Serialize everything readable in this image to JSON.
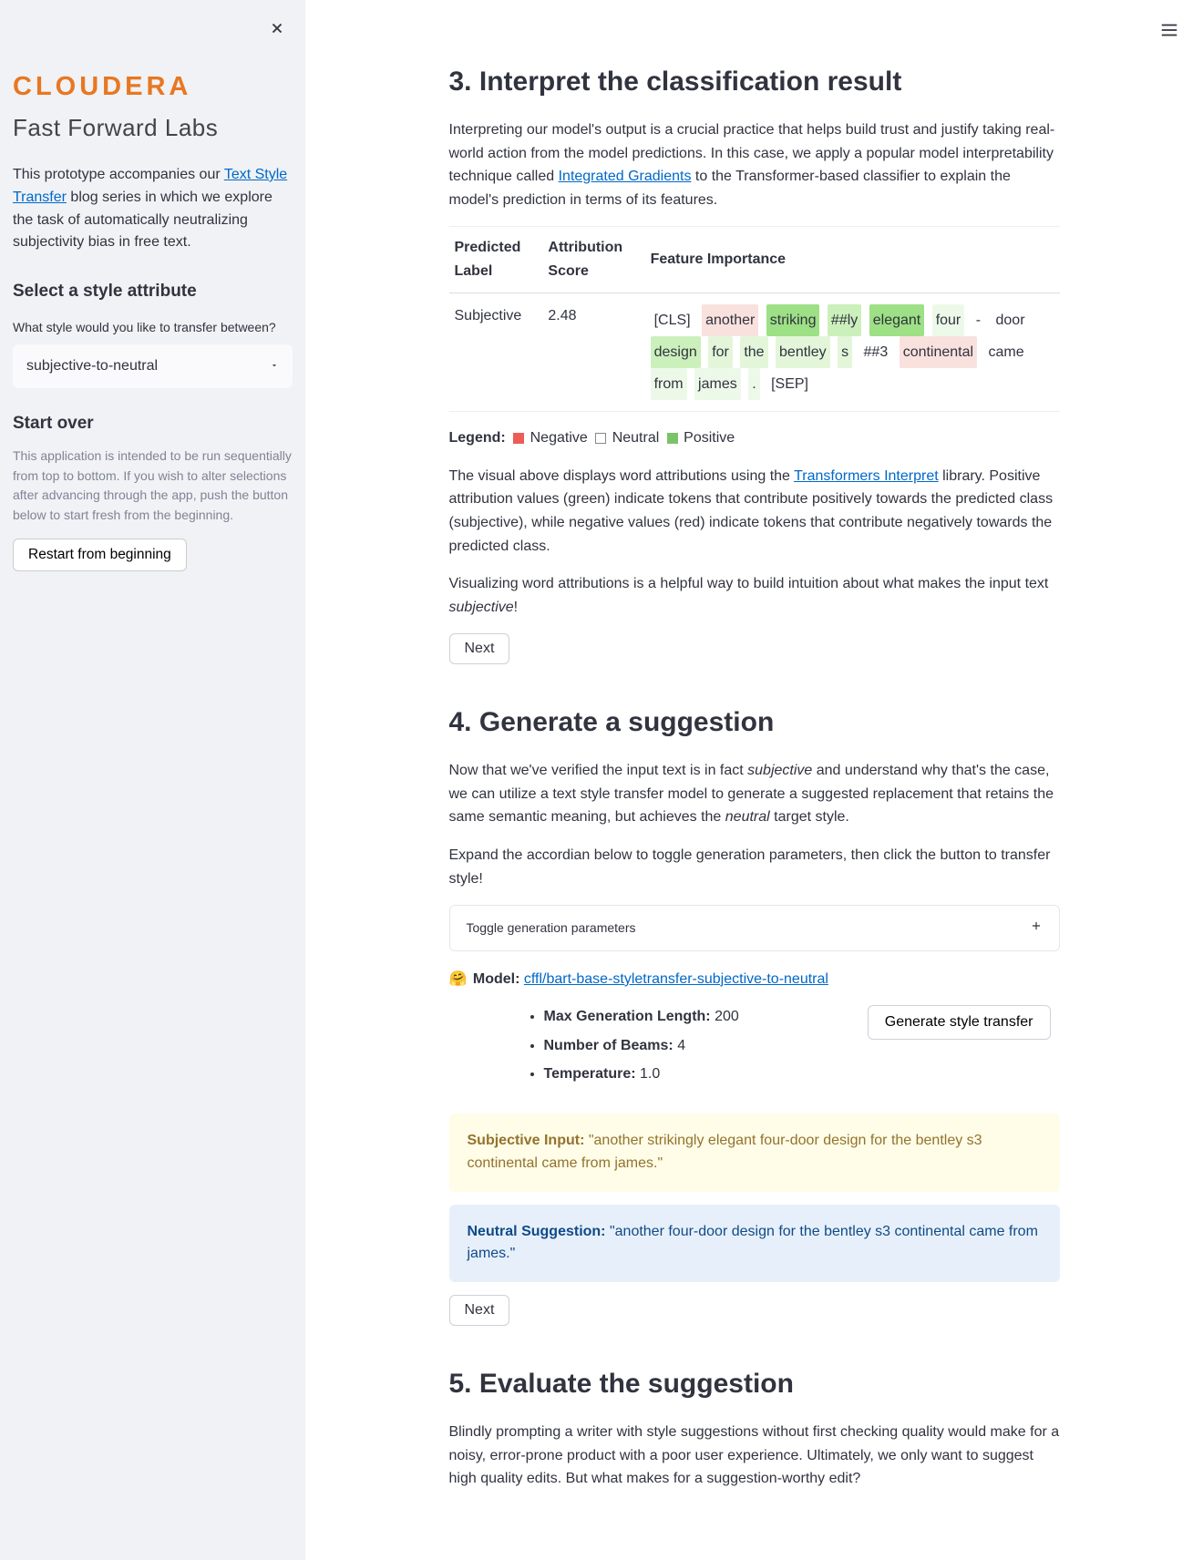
{
  "sidebar": {
    "logo_main": "CLOUDERA",
    "logo_sub": "Fast Forward Labs",
    "intro_prefix": "This prototype accompanies our ",
    "intro_link": "Text Style Transfer",
    "intro_suffix": " blog series in which we explore the task of automatically neutralizing subjectivity bias in free text.",
    "select_heading": "Select a style attribute",
    "select_label": "What style would you like to transfer between?",
    "select_value": "subjective-to-neutral",
    "startover_heading": "Start over",
    "startover_hint": "This application is intended to be run sequentially from top to bottom. If you wish to alter selections after advancing through the app, push the button below to start fresh from the beginning.",
    "restart_label": "Restart from beginning"
  },
  "section3": {
    "title": "3. Interpret the classification result",
    "para1_a": "Interpreting our model's output is a crucial practice that helps build trust and justify taking real-world action from the model predictions. In this case, we apply a popular model interpretability technique called ",
    "para1_link": "Integrated Gradients",
    "para1_b": " to the Transformer-based classifier to explain the model's prediction in terms of its features.",
    "th1": "Predicted Label",
    "th2": "Attribution Score",
    "th3": "Feature Importance",
    "predicted_label": "Subjective",
    "attribution_score": "2.48",
    "tokens": [
      {
        "text": "[CLS]",
        "bg": ""
      },
      {
        "text": "another",
        "bg": "#f9e1de"
      },
      {
        "text": "striking",
        "bg": "#9de085"
      },
      {
        "text": "##ly",
        "bg": "#cbf0bb"
      },
      {
        "text": "elegant",
        "bg": "#9de085"
      },
      {
        "text": "four",
        "bg": "#edf9e8"
      },
      {
        "text": "-",
        "bg": ""
      },
      {
        "text": "door",
        "bg": ""
      },
      {
        "text": "design",
        "bg": "#cbf0bb"
      },
      {
        "text": "for",
        "bg": "#e3f6d9"
      },
      {
        "text": "the",
        "bg": "#e3f6d9"
      },
      {
        "text": "bentley",
        "bg": "#e3f6d9"
      },
      {
        "text": "s",
        "bg": "#e3f6d9"
      },
      {
        "text": "##3",
        "bg": ""
      },
      {
        "text": "continental",
        "bg": "#f9e1de"
      },
      {
        "text": "came",
        "bg": ""
      },
      {
        "text": "from",
        "bg": "#edf9e8"
      },
      {
        "text": "james",
        "bg": "#edf9e8"
      },
      {
        "text": ".",
        "bg": "#edf9e8"
      },
      {
        "text": "[SEP]",
        "bg": ""
      }
    ],
    "legend_label": "Legend:",
    "legend_neg": "Negative",
    "legend_neu": "Neutral",
    "legend_pos": "Positive",
    "para2_a": "The visual above displays word attributions using the ",
    "para2_link": "Transformers Interpret",
    "para2_b": " library. Positive attribution values (green) indicate tokens that contribute positively towards the predicted class (subjective), while negative values (red) indicate tokens that contribute negatively towards the predicted class.",
    "para3_a": "Visualizing word attributions is a helpful way to build intuition about what makes the input text ",
    "para3_em": "subjective",
    "para3_b": "!",
    "next_label": "Next"
  },
  "section4": {
    "title": "4. Generate a suggestion",
    "para1_a": "Now that we've verified the input text is in fact ",
    "para1_em1": "subjective",
    "para1_b": " and understand why that's the case, we can utilize a text style transfer model to generate a suggested replacement that retains the same semantic meaning, but achieves the ",
    "para1_em2": "neutral",
    "para1_c": " target style.",
    "para2": "Expand the accordian below to toggle generation parameters, then click the button to transfer style!",
    "expander_label": "Toggle generation parameters",
    "model_prefix": "🤗 ",
    "model_label_bold": "Model:",
    "model_link": "cffl/bart-base-styletransfer-subjective-to-neutral",
    "param1_label": "Max Generation Length:",
    "param1_value": " 200",
    "param2_label": "Number of Beams:",
    "param2_value": " 4",
    "param3_label": "Temperature:",
    "param3_value": " 1.0",
    "gen_button": "Generate style transfer",
    "input_label": "Subjective Input:",
    "input_text": " \"another strikingly elegant four-door design for the bentley s3 continental came from james.\"",
    "suggestion_label": "Neutral Suggestion:",
    "suggestion_text": " \"another four-door design for the bentley s3 continental came from james.\"",
    "next_label": "Next"
  },
  "section5": {
    "title": "5. Evaluate the suggestion",
    "para1": "Blindly prompting a writer with style suggestions without first checking quality would make for a noisy, error-prone product with a poor user experience. Ultimately, we only want to suggest high quality edits. But what makes for a suggestion-worthy edit?"
  }
}
